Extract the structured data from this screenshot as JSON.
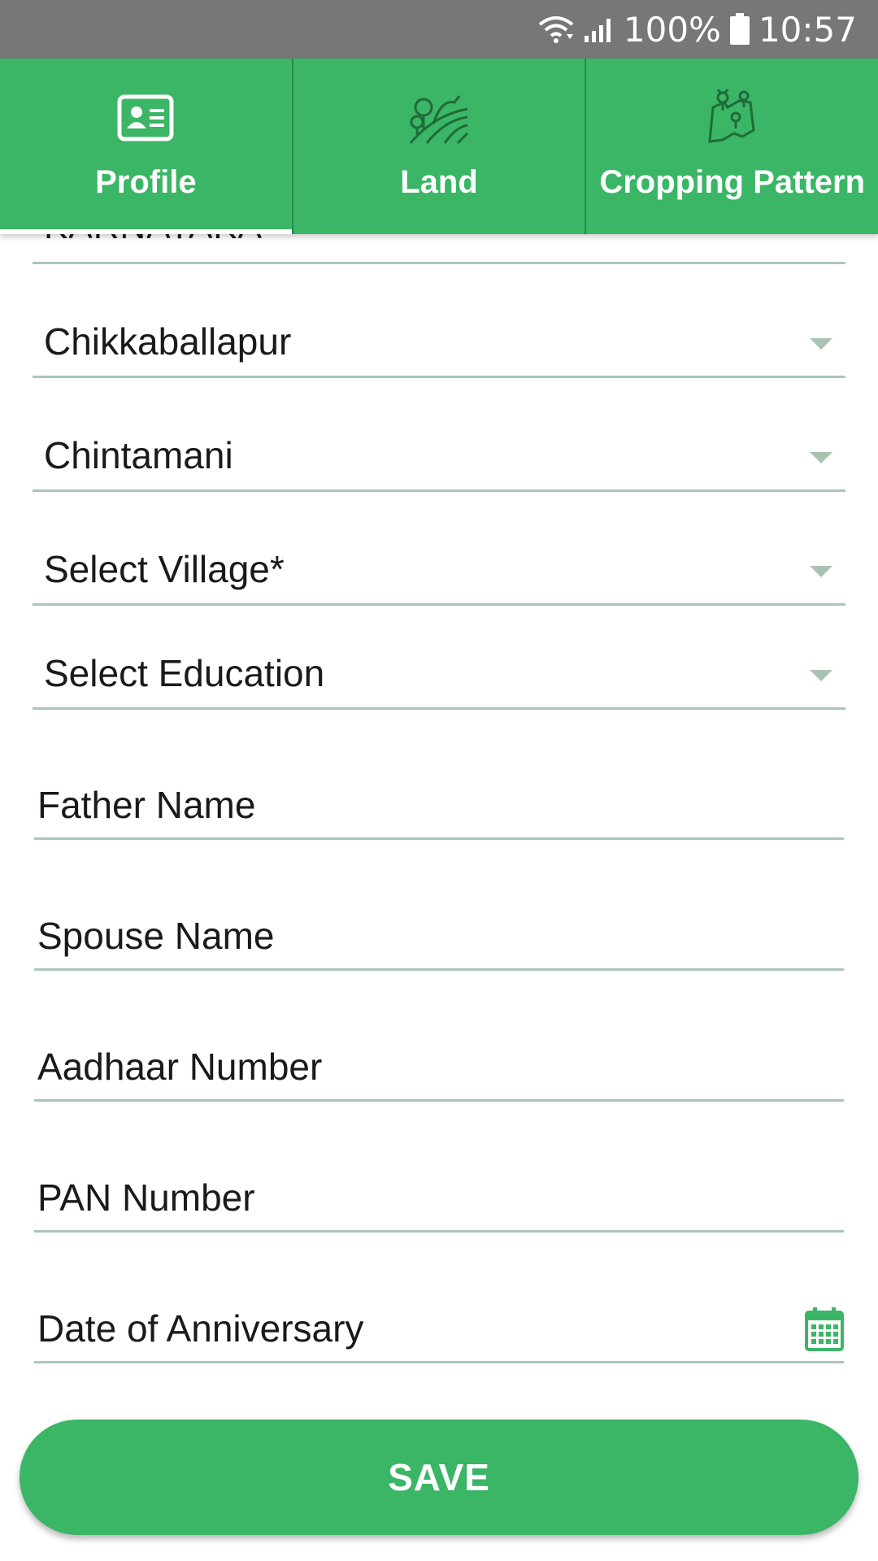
{
  "status_bar": {
    "battery": "100%",
    "time": "10:57",
    "icons": [
      "wifi-icon",
      "signal-icon",
      "battery-icon"
    ]
  },
  "tabs": [
    {
      "label": "Profile",
      "icon": "profile-card-icon",
      "selected": true
    },
    {
      "label": "Land",
      "icon": "land-field-icon",
      "selected": false
    },
    {
      "label": "Cropping Pattern",
      "icon": "map-pins-icon",
      "selected": false
    }
  ],
  "form": {
    "state_value_cut": "KARNATAKA",
    "district": "Chikkaballapur",
    "taluk": "Chintamani",
    "village": "Select Village*",
    "education": "Select Education",
    "father_name_placeholder": "Father Name",
    "spouse_name_placeholder": "Spouse Name",
    "aadhaar_placeholder": "Aadhaar Number",
    "pan_placeholder": "PAN Number",
    "anniversary_placeholder": "Date of Anniversary"
  },
  "save_label": "SAVE",
  "colors": {
    "primary": "#3bb566",
    "status_bar": "#777777",
    "underline": "#aac7b6"
  }
}
